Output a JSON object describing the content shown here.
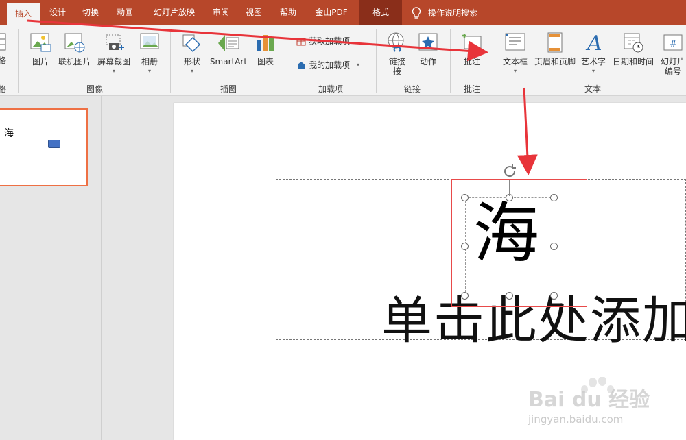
{
  "tabs": [
    {
      "label": "插入",
      "active": true
    },
    {
      "label": "设计"
    },
    {
      "label": "切换"
    },
    {
      "label": "动画"
    },
    {
      "label": "幻灯片放映"
    },
    {
      "label": "审阅"
    },
    {
      "label": "视图"
    },
    {
      "label": "帮助"
    },
    {
      "label": "金山PDF"
    },
    {
      "label": "格式"
    }
  ],
  "tell_me": "操作说明搜索",
  "ribbon": {
    "partial_left_label": "格",
    "partial_left_group": "格",
    "images": {
      "picture": "图片",
      "online_picture": "联机图片",
      "screenshot": "屏幕截图",
      "album": "相册",
      "group": "图像"
    },
    "illustrations": {
      "shapes": "形状",
      "smartart": "SmartArt",
      "chart": "图表",
      "group": "插图"
    },
    "addins": {
      "get": "获取加载项",
      "mine": "我的加载项",
      "group": "加载项"
    },
    "links": {
      "link": "链接",
      "link_2": "接",
      "action": "动作",
      "group": "链接"
    },
    "comments": {
      "comment": "批注",
      "group": "批注"
    },
    "text": {
      "textbox": "文本框",
      "header_footer": "页眉和页脚",
      "wordart": "艺术字",
      "datetime": "日期和时间",
      "slide_no": "幻灯片",
      "slide_no_2": "编号",
      "group": "文本"
    }
  },
  "thumbnail": {
    "text": "海"
  },
  "slide": {
    "selected_text": "海",
    "placeholder_text": "单击此处添加"
  },
  "watermark": {
    "text": "Bai du 经验",
    "url": "jingyan.baidu.com"
  },
  "colors": {
    "accent": "#b7472a",
    "arrow": "#e8343a",
    "selection": "#e84a4a"
  }
}
